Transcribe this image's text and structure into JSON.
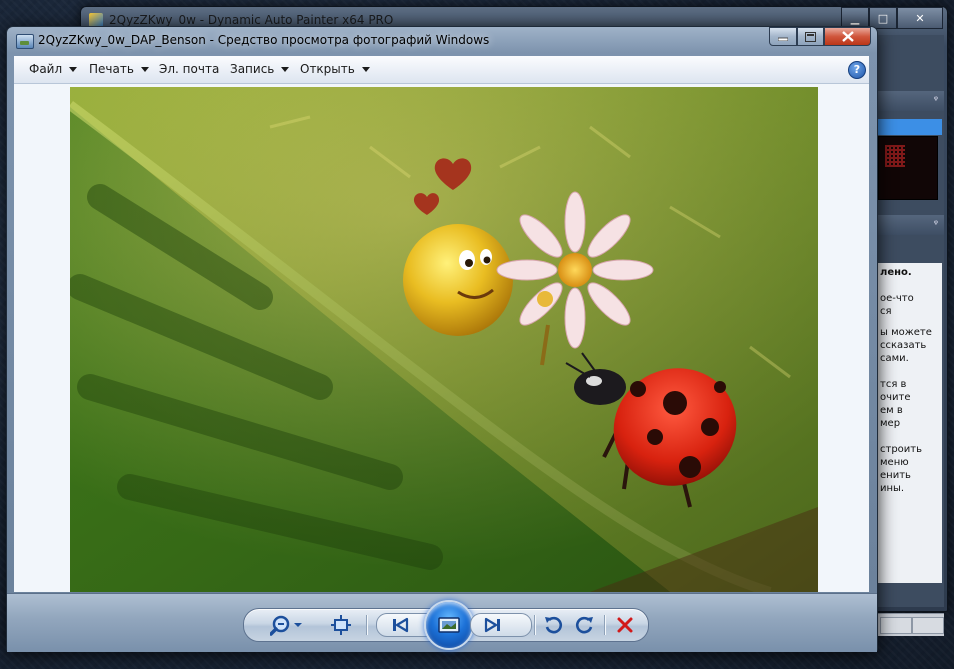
{
  "back_window": {
    "title": "2QyzZKwy_0w - Dynamic Auto Painter x64 PRO",
    "help_text": [
      "лено.",
      "ое-что",
      "ся",
      "ы можете",
      "ссказать",
      "сами.",
      "тся в",
      "очите",
      "ем в",
      "мер",
      "строить",
      "меню",
      "енить",
      "ины."
    ]
  },
  "window": {
    "title": "2QyzZKwy_0w_DAP_Benson - Средство просмотра фотографий Windows",
    "minimize_icon": "minimize-icon",
    "maximize_icon": "maximize-icon",
    "close_icon": "close-icon"
  },
  "menu": {
    "file": "Файл",
    "print": "Печать",
    "email": "Эл. почта",
    "burn": "Запись",
    "open": "Открыть",
    "help_glyph": "?"
  },
  "photo": {
    "subject": "painted-ladybug-smiley-daisy-on-leaf"
  },
  "controls": {
    "zoom_icon": "zoom-icon",
    "actual_size_icon": "actual-size-icon",
    "previous_icon": "previous-icon",
    "slideshow_icon": "slideshow-icon",
    "next_icon": "next-icon",
    "rotate_ccw_icon": "rotate-counterclockwise-icon",
    "rotate_cw_icon": "rotate-clockwise-icon",
    "delete_icon": "delete-icon"
  },
  "colors": {
    "accent_blue": "#1d72d8",
    "close_red": "#d0563c",
    "delete_red": "#d21a1a"
  }
}
